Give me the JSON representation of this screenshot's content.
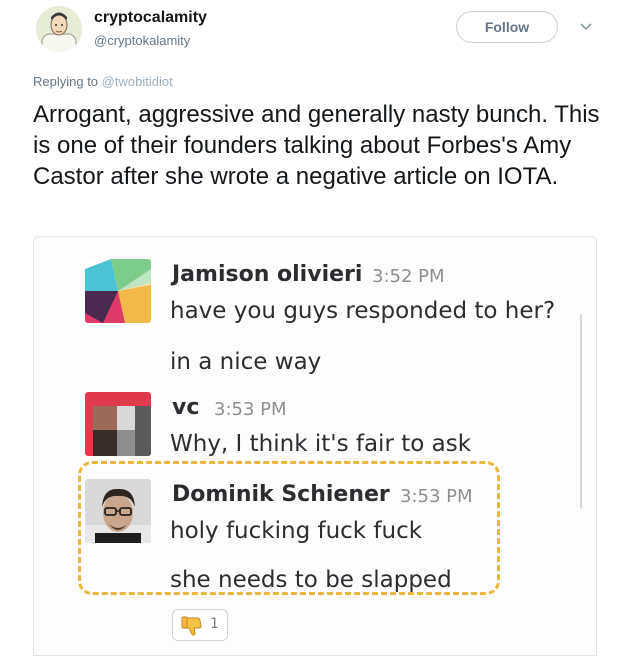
{
  "tweet": {
    "author_name": "cryptocalamity",
    "author_handle": "@cryptokalamity",
    "follow_label": "Follow",
    "replying_prefix": "Replying to",
    "replying_to": "@twobitidiot",
    "text": "Arrogant, aggressive and generally nasty bunch. This is one of their founders talking about Forbes's Amy Castor after she wrote a negative article on IOTA."
  },
  "chat": {
    "messages": [
      {
        "sender": "Jamison olivieri",
        "time": "3:52 PM",
        "lines": [
          "have you guys responded to her?",
          "in a nice way"
        ]
      },
      {
        "sender": "vc",
        "time": "3:53 PM",
        "lines": [
          "Why, I think it's fair to ask"
        ]
      },
      {
        "sender": "Dominik Schiener",
        "time": "3:53 PM",
        "lines": [
          "holy fucking fuck fuck",
          "she needs to be slapped"
        ]
      }
    ],
    "reaction": {
      "icon": "thumbs-down-icon",
      "count": "1"
    },
    "highlight_color": "#e9b83f"
  },
  "colors": {
    "text": "#14171a",
    "secondary": "#657786",
    "border": "#e1e8ed"
  }
}
